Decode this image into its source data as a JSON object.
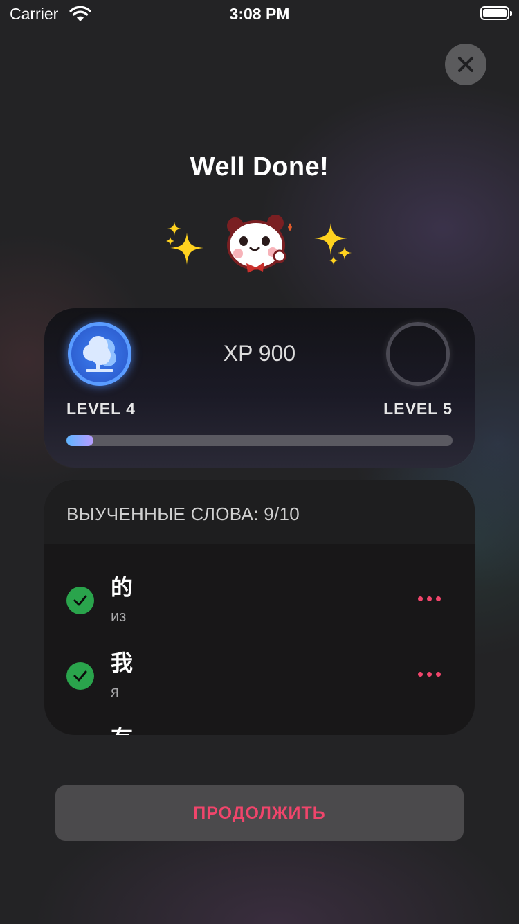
{
  "status_bar": {
    "carrier": "Carrier",
    "time": "3:08 PM"
  },
  "header": {
    "title": "Well Done!"
  },
  "progress_card": {
    "xp_label": "XP 900",
    "current_level": "LEVEL 4",
    "next_level": "LEVEL 5",
    "progress_fraction": 0.07,
    "current_badge_icon": "tree-icon"
  },
  "learned_words": {
    "title": "ВЫУЧЕННЫЕ СЛОВА: 9/10",
    "items": [
      {
        "word": "的",
        "translation": "из",
        "learned": true
      },
      {
        "word": "我",
        "translation": "я",
        "learned": true
      },
      {
        "word": "有",
        "translation": "",
        "learned": false
      }
    ]
  },
  "actions": {
    "continue_label": "ПРОДОЛЖИТЬ"
  },
  "colors": {
    "accent": "#f0456b",
    "check": "#2aa44c",
    "badge": "#3c7ef1",
    "background": "#232325"
  }
}
